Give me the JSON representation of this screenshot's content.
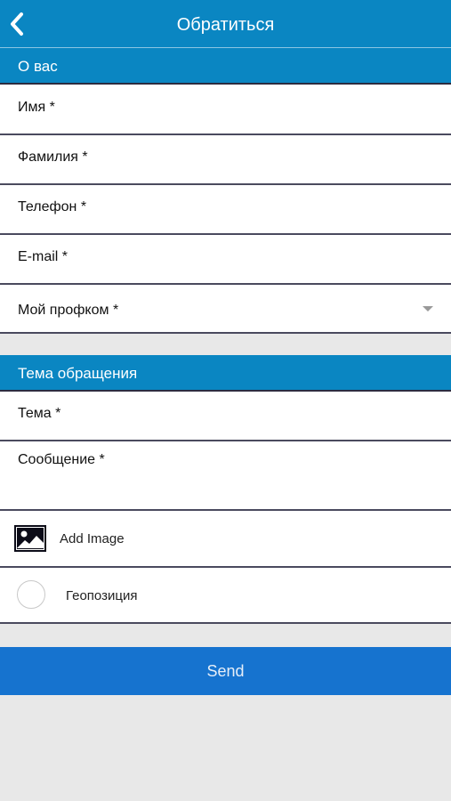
{
  "header": {
    "title": "Обратиться",
    "back_icon": "chevron-left-icon"
  },
  "about_section": {
    "title": "О вас",
    "fields": [
      {
        "label": "Имя *"
      },
      {
        "label": "Фамилия *"
      },
      {
        "label": "Телефон *"
      },
      {
        "label": "E-mail *"
      },
      {
        "label": "Мой профком *"
      }
    ]
  },
  "topic_section": {
    "title": "Тема обращения",
    "fields": [
      {
        "label": "Тема *"
      },
      {
        "label": "Сообщение *"
      }
    ]
  },
  "actions": {
    "add_image": "Add Image",
    "add_image_icon": "image-icon",
    "geo": "Геопозиция",
    "geo_icon": "radio-icon"
  },
  "send_button": "Send",
  "colors": {
    "header": "#0a86c2",
    "send": "#1673cf",
    "background": "#e8e8e8"
  }
}
